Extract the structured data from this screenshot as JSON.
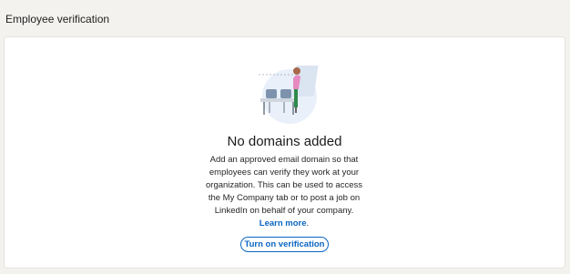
{
  "section": {
    "title": "Employee verification"
  },
  "empty_state": {
    "illustration_icon": "person-hanging-poster-office-illustration",
    "title": "No domains added",
    "description": "Add an approved email domain so that employees can verify they work at your organization. This can be used to access the My Company tab or to post a job on LinkedIn on behalf of your company.",
    "learn_more_label": "Learn more",
    "button_label": "Turn on verification"
  },
  "colors": {
    "page_background": "#f3f2ef",
    "card_background": "#ffffff",
    "accent": "#0a66c2"
  }
}
